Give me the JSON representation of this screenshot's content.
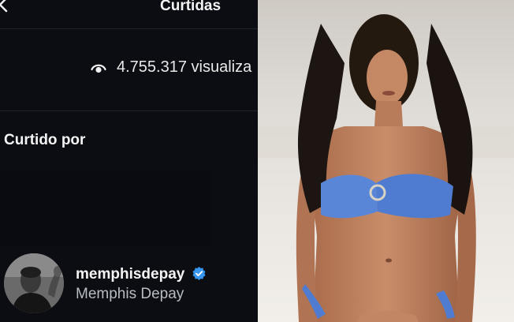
{
  "header": {
    "title": "Curtidas"
  },
  "views": {
    "count_text": "4.755.317 visualiza"
  },
  "likes_section": {
    "title": "Curtido por"
  },
  "liker": {
    "username": "memphisdepay",
    "full_name": "Memphis Depay",
    "verified": true
  },
  "colors": {
    "background": "#0c0d12",
    "verified_blue": "#3797f0",
    "bikini_blue": "#5a86d8"
  },
  "icons": [
    "back-arrow-icon",
    "eye-icon",
    "verified-badge-icon"
  ]
}
